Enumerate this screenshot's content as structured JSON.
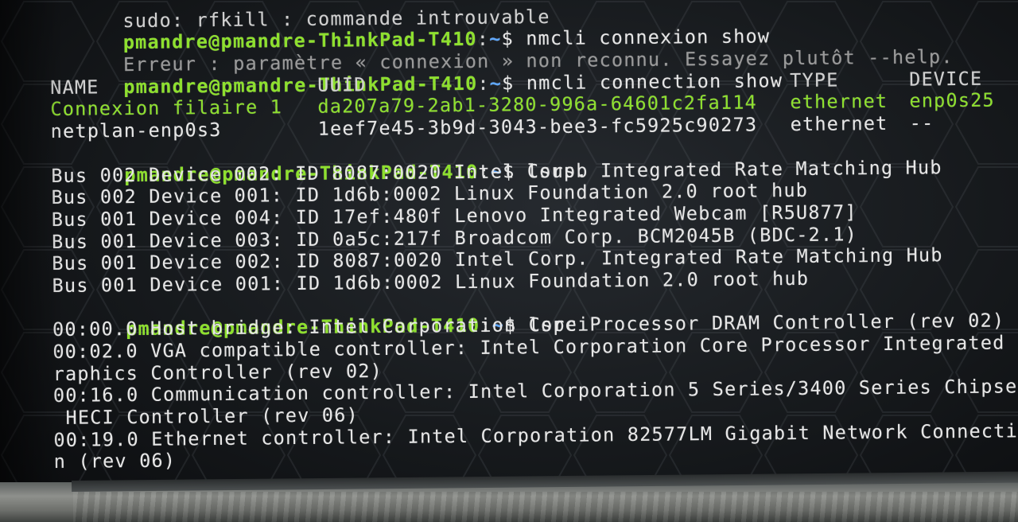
{
  "terminal": {
    "prompt": {
      "user_host": "pmandre@pmandre-ThinkPad-T410",
      "separator": ":",
      "path": "~",
      "dollar": "$"
    },
    "lines": {
      "l0_partial": "sudo: rfkill : commande introuvable",
      "l1_cmd": " nmcli connexion show",
      "l2_error": "Erreur : paramètre « connexion » non reconnu. Essayez plutôt --help.",
      "l3_cmd": " nmcli connection show",
      "l13_cmd": " lsusb",
      "l20_cmd": " lspci"
    },
    "nmcli_table": {
      "headers": [
        "NAME",
        "UUID",
        "TYPE",
        "DEVICE"
      ],
      "rows": [
        [
          "Connexion filaire 1",
          "da207a79-2ab1-3280-996a-64601c2fa114",
          "ethernet",
          "enp0s25"
        ],
        [
          "netplan-enp0s3",
          "1eef7e45-3b9d-3043-bee3-fc5925c90273",
          "ethernet",
          "--"
        ]
      ]
    },
    "lsusb_output": [
      "Bus 002 Device 002: ID 8087:0020 Intel Corp. Integrated Rate Matching Hub",
      "Bus 002 Device 001: ID 1d6b:0002 Linux Foundation 2.0 root hub",
      "Bus 001 Device 004: ID 17ef:480f Lenovo Integrated Webcam [R5U877]",
      "Bus 001 Device 003: ID 0a5c:217f Broadcom Corp. BCM2045B (BDC-2.1)",
      "Bus 001 Device 002: ID 8087:0020 Intel Corp. Integrated Rate Matching Hub",
      "Bus 001 Device 001: ID 1d6b:0002 Linux Foundation 2.0 root hub"
    ],
    "lspci_output": [
      "00:00.0 Host bridge: Intel Corporation Core Processor DRAM Controller (rev 02)",
      "00:02.0 VGA compatible controller: Intel Corporation Core Processor Integrated",
      "raphics Controller (rev 02)",
      "00:16.0 Communication controller: Intel Corporation 5 Series/3400 Series Chipse",
      " HECI Controller (rev 06)",
      "00:19.0 Ethernet controller: Intel Corporation 82577LM Gigabit Network Connecti",
      "n (rev 06)"
    ]
  },
  "colors": {
    "prompt_user": "#8ee02e",
    "prompt_path": "#5fa8ff",
    "text": "#e6e6e6",
    "error_text": "#9a9a9a",
    "active_connection": "#8ee02e"
  }
}
